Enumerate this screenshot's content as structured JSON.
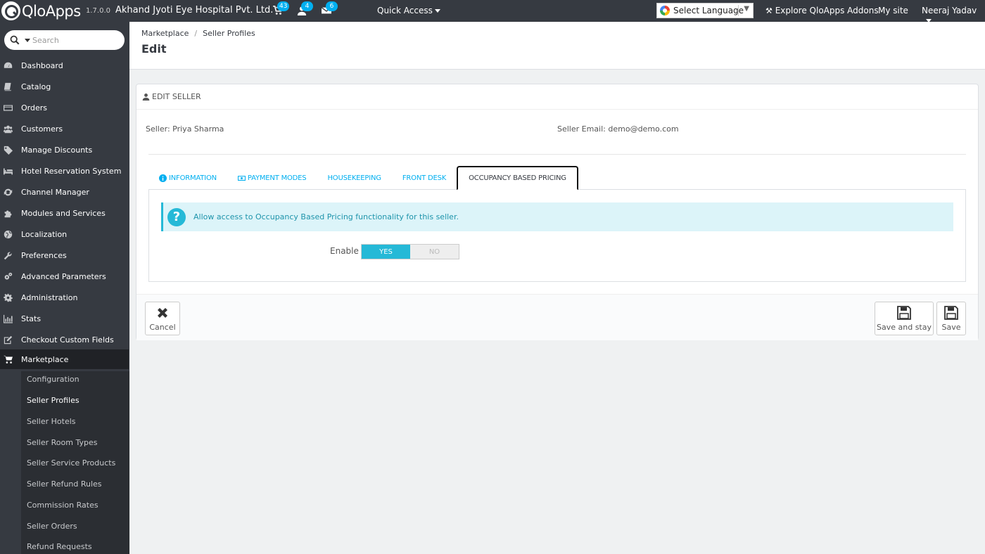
{
  "header": {
    "logo_text": "QloApps",
    "version": "1.7.0.0",
    "shop_name": "Akhand Jyoti Eye Hospital Pvt. Ltd.",
    "badges": {
      "orders": "43",
      "customers": "4",
      "messages": "6"
    },
    "quick_access": "Quick Access",
    "language": "Select Language",
    "explore": "Explore QloApps Addons",
    "my_site": "My site",
    "user": "Neeraj Yadav"
  },
  "sidebar": {
    "search_placeholder": "Search",
    "items": [
      {
        "label": "Dashboard",
        "icon": "dashboard-icon"
      },
      {
        "label": "Catalog",
        "icon": "book-icon"
      },
      {
        "label": "Orders",
        "icon": "credit-card-icon"
      },
      {
        "label": "Customers",
        "icon": "users-icon"
      },
      {
        "label": "Manage Discounts",
        "icon": "tag-icon"
      },
      {
        "label": "Hotel Reservation System",
        "icon": "bed-icon"
      },
      {
        "label": "Channel Manager",
        "icon": "refresh-icon"
      },
      {
        "label": "Modules and Services",
        "icon": "puzzle-icon"
      },
      {
        "label": "Localization",
        "icon": "globe-icon"
      },
      {
        "label": "Preferences",
        "icon": "wrench-icon"
      },
      {
        "label": "Advanced Parameters",
        "icon": "cogs-icon"
      },
      {
        "label": "Administration",
        "icon": "gear-icon"
      },
      {
        "label": "Stats",
        "icon": "bar-chart-icon"
      },
      {
        "label": "Checkout Custom Fields",
        "icon": "edit-icon"
      },
      {
        "label": "Marketplace",
        "icon": "cart-icon"
      }
    ],
    "sub_items": [
      "Configuration",
      "Seller Profiles",
      "Seller Hotels",
      "Seller Room Types",
      "Seller Service Products",
      "Seller Refund Rules",
      "Commission Rates",
      "Seller Orders",
      "Refund Requests"
    ]
  },
  "page": {
    "breadcrumb": [
      "Marketplace",
      "Seller Profiles"
    ],
    "title": "Edit"
  },
  "panel": {
    "heading": "EDIT SELLER",
    "seller_name": "Seller: Priya Sharma",
    "seller_email": "Seller Email: demo@demo.com",
    "tabs": [
      "INFORMATION",
      "PAYMENT MODES",
      "HOUSEKEEPING",
      "FRONT DESK",
      "OCCUPANCY BASED PRICING"
    ],
    "alert_text": "Allow access to Occupancy Based Pricing functionality for this seller.",
    "enable_label": "Enable",
    "switch_yes": "YES",
    "switch_no": "NO",
    "cancel": "Cancel",
    "save_and_stay": "Save and stay",
    "save": "Save"
  },
  "colors": {
    "header_bg": "#363a41",
    "accent": "#25b9d7",
    "link": "#00aff0"
  }
}
